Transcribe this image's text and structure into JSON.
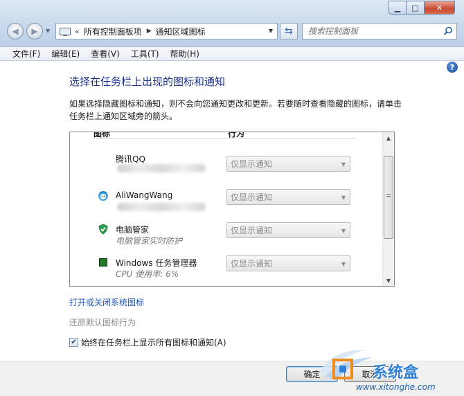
{
  "window": {
    "controls": {
      "minimize": "▁",
      "maximize": "□",
      "close": "✕"
    }
  },
  "address": {
    "overflow": "«",
    "crumbs": [
      "所有控制面板项",
      "通知区域图标"
    ],
    "separator": "▶"
  },
  "search": {
    "placeholder": "搜索控制面板"
  },
  "menu": [
    "文件(F)",
    "编辑(E)",
    "查看(V)",
    "工具(T)",
    "帮助(H)"
  ],
  "content": {
    "title": "选择在任务栏上出现的图标和通知",
    "description": "如果选择隐藏图标和通知，则不会向您通知更改和更新。若要随时查看隐藏的图标，请单击任务栏上通知区域旁的箭头。"
  },
  "table": {
    "columns": [
      "图标",
      "行为"
    ],
    "rows": [
      {
        "name": "腾讯QQ",
        "subtitle": "",
        "behavior": "仅显示通知",
        "icon": "qq-icon"
      },
      {
        "name": "AliWangWang",
        "subtitle": "",
        "behavior": "仅显示通知",
        "icon": "aliwangwang-icon"
      },
      {
        "name": "电脑管家",
        "subtitle": "电脑管家实时防护",
        "behavior": "仅显示通知",
        "icon": "pc-manager-shield-icon"
      },
      {
        "name": "Windows 任务管理器",
        "subtitle": "CPU 使用率: 6%",
        "behavior": "仅显示通知",
        "icon": "task-manager-icon"
      }
    ]
  },
  "links": {
    "toggle_system_icons": "打开或关闭系统图标",
    "restore_defaults": "还原默认图标行为"
  },
  "checkbox": {
    "label": "始终在任务栏上显示所有图标和通知(A)",
    "checked": true,
    "mark": "✔"
  },
  "buttons": {
    "ok": "确定",
    "cancel": "取消"
  },
  "watermark": {
    "brand": "系统盒",
    "url": "www.xitonghe.com"
  },
  "colors": {
    "title_blue": "#1e3287",
    "link_blue": "#1f56b4",
    "disabled_gray": "#8c8c8c"
  }
}
